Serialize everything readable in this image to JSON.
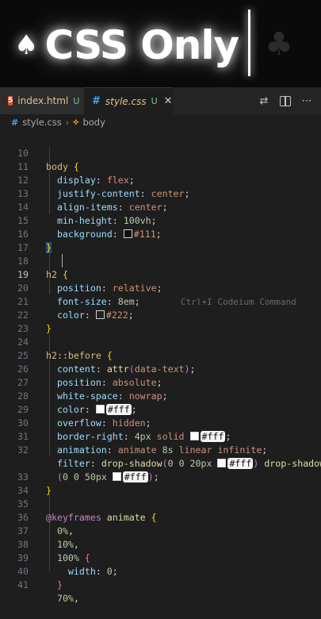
{
  "hero": {
    "title": "CSS Only",
    "left_icon": "spade-icon",
    "right_icon": "club-icon"
  },
  "tabs": [
    {
      "label": "index.html",
      "badge": "U",
      "icon": "html-icon"
    },
    {
      "label": "style.css",
      "badge": "U",
      "icon": "css-icon",
      "active": true
    }
  ],
  "tab_actions": [
    "source-control-icon",
    "split-editor-icon",
    "more-icon"
  ],
  "breadcrumb": {
    "file": "style.css",
    "symbol": "body"
  },
  "ghost_hint": "Ctrl+I Codeium Command",
  "current_line": 19,
  "colors": {
    "accent_blue": "#42a5f5",
    "git_untracked": "#73c991",
    "selector": "#d7ba7d",
    "property": "#9cdcfe",
    "value": "#ce9178"
  },
  "code_lines": [
    {
      "n": "10"
    },
    {
      "n": "11"
    },
    {
      "n": "12"
    },
    {
      "n": "13"
    },
    {
      "n": "14"
    },
    {
      "n": "15"
    },
    {
      "n": "16"
    },
    {
      "n": "17"
    },
    {
      "n": "18"
    },
    {
      "n": "19"
    },
    {
      "n": "20"
    },
    {
      "n": "21"
    },
    {
      "n": "22"
    },
    {
      "n": "23"
    },
    {
      "n": "24"
    },
    {
      "n": "25"
    },
    {
      "n": "26"
    },
    {
      "n": "27"
    },
    {
      "n": "28"
    },
    {
      "n": "29"
    },
    {
      "n": "30"
    },
    {
      "n": "31"
    },
    {
      "n": "32"
    },
    {
      "n": ""
    },
    {
      "n": "33"
    },
    {
      "n": "34"
    },
    {
      "n": "35"
    },
    {
      "n": "36"
    },
    {
      "n": "37"
    },
    {
      "n": "38"
    },
    {
      "n": "39"
    },
    {
      "n": "40"
    },
    {
      "n": "41"
    }
  ],
  "code": {
    "body_sel": "body",
    "display": "display",
    "flex": "flex",
    "justify": "justify-content",
    "center": "center",
    "align": "align-items",
    "minh": "min-height",
    "vh": "100vh",
    "bg": "background",
    "c111": "#111",
    "h2": "h2",
    "position": "position",
    "relative": "relative",
    "fontsize": "font-size",
    "em8": "8em",
    "color": "color",
    "c222": "#222",
    "h2before": "h2::before",
    "content": "content",
    "attr": "attr",
    "datatext": "data-text",
    "absolute": "absolute",
    "ws": "white-space",
    "nowrap": "nowrap",
    "cfff": "#fff",
    "overflow": "overflow",
    "hidden": "hidden",
    "borderright": "border-right",
    "px4": "4px",
    "solid": "solid",
    "animation": "animation",
    "animate": "animate",
    "s8": "8s",
    "linear": "linear",
    "infinite": "infinite",
    "filter": "filter",
    "dropshadow": "drop-shadow",
    "zero": "0",
    "px20": "20px",
    "px50": "50px",
    "keyframes": "@keyframes",
    "p0": "0%",
    "p10": "10%",
    "p100": "100%",
    "width": "width",
    "p70": "70%"
  }
}
